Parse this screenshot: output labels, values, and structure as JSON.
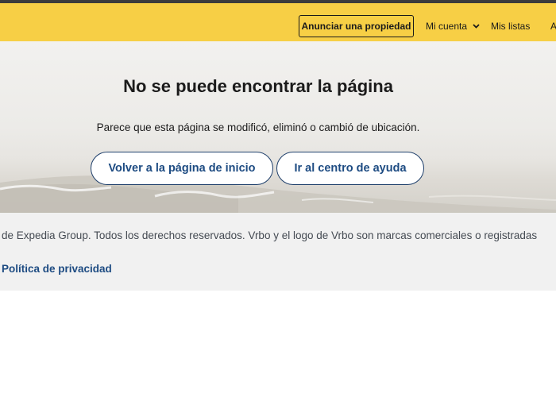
{
  "header": {
    "list_property_label": "Anunciar una propiedad",
    "account_label": "Mi cuenta",
    "my_lists_label": "Mis listas",
    "overflow_label": "A",
    "icons": {
      "account_menu": "chevron-down-icon"
    },
    "colors": {
      "background": "#f7cf45",
      "text": "#1a1a1a"
    }
  },
  "hero": {
    "title": "No se puede encontrar la página",
    "subtitle": "Parece que esta página se modificó, eliminó o cambió de ubicación.",
    "home_button_label": "Volver a la página de inicio",
    "help_button_label": "Ir al centro de ayuda",
    "colors": {
      "button_text": "#1d4b82"
    }
  },
  "footer": {
    "copyright": "de Expedia Group. Todos los derechos reservados. Vrbo y el logo de Vrbo son marcas comerciales o registradas",
    "privacy_link": "Política de privacidad",
    "colors": {
      "background": "#f1f1f1",
      "link": "#1d4b82"
    }
  }
}
